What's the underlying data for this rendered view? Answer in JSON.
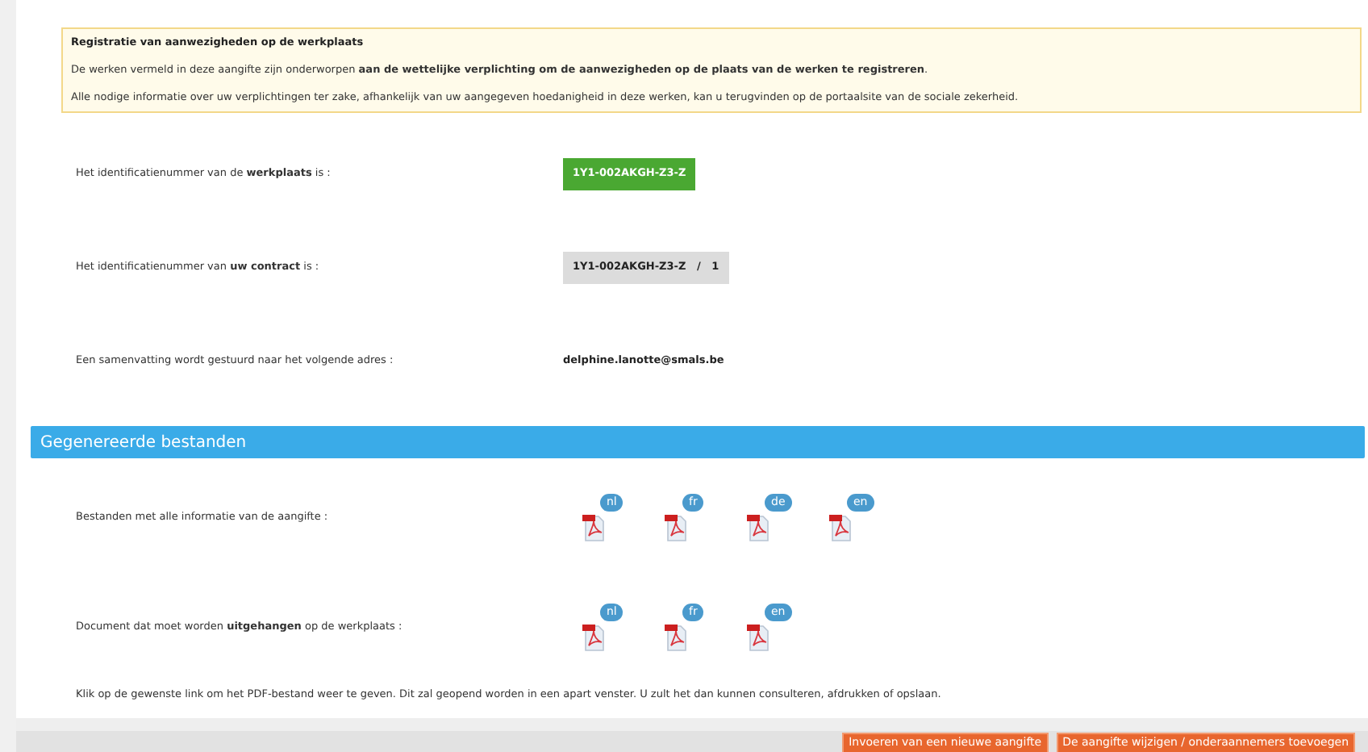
{
  "notice": {
    "title": "Registratie van aanwezigheden op de werkplaats",
    "paragraphs": [
      "De werken vermeld in deze aangifte zijn onderworpen **aan de wettelijke verplichting om de aanwezigheden op de plaats van de werken te registreren**.",
      "Alle nodige informatie over uw verplichtingen ter zake, afhankelijk van uw aangegeven hoedanigheid in deze werken, kan u terugvinden op de portaalsite van de sociale zekerheid."
    ]
  },
  "info_rows": [
    {
      "label": "Het identificatienummer van de **werkplaats** is :",
      "value": "1Y1-002AKGH-Z3-Z",
      "kind": "green"
    },
    {
      "label": "Het identificatienummer van **uw contract** is :",
      "value": "1Y1-002AKGH-Z3-Z   /   1",
      "kind": "gray"
    },
    {
      "label": "Een samenvatting wordt gestuurd naar het volgende adres :",
      "value": "delphine.lanotte@smals.be",
      "kind": "plain"
    }
  ],
  "section": {
    "title": "Gegenereerde bestanden"
  },
  "file_rows": [
    {
      "label": "Bestanden met alle informatie van de aangifte :",
      "files": [
        "nl",
        "fr",
        "de",
        "en"
      ]
    },
    {
      "label": "Document dat moet worden **uitgehangen** op de werkplaats :",
      "files": [
        "nl",
        "fr",
        "en"
      ]
    }
  ],
  "note": "Klik op de gewenste link om het PDF-bestand weer te geven. Dit zal geopend worden in een apart venster. U zult het dan kunnen consulteren, afdrukken of opslaan.",
  "buttons": [
    "Invoeren van een nieuwe aangifte",
    "De aangifte wijzigen / onderaannemers toevoegen"
  ]
}
